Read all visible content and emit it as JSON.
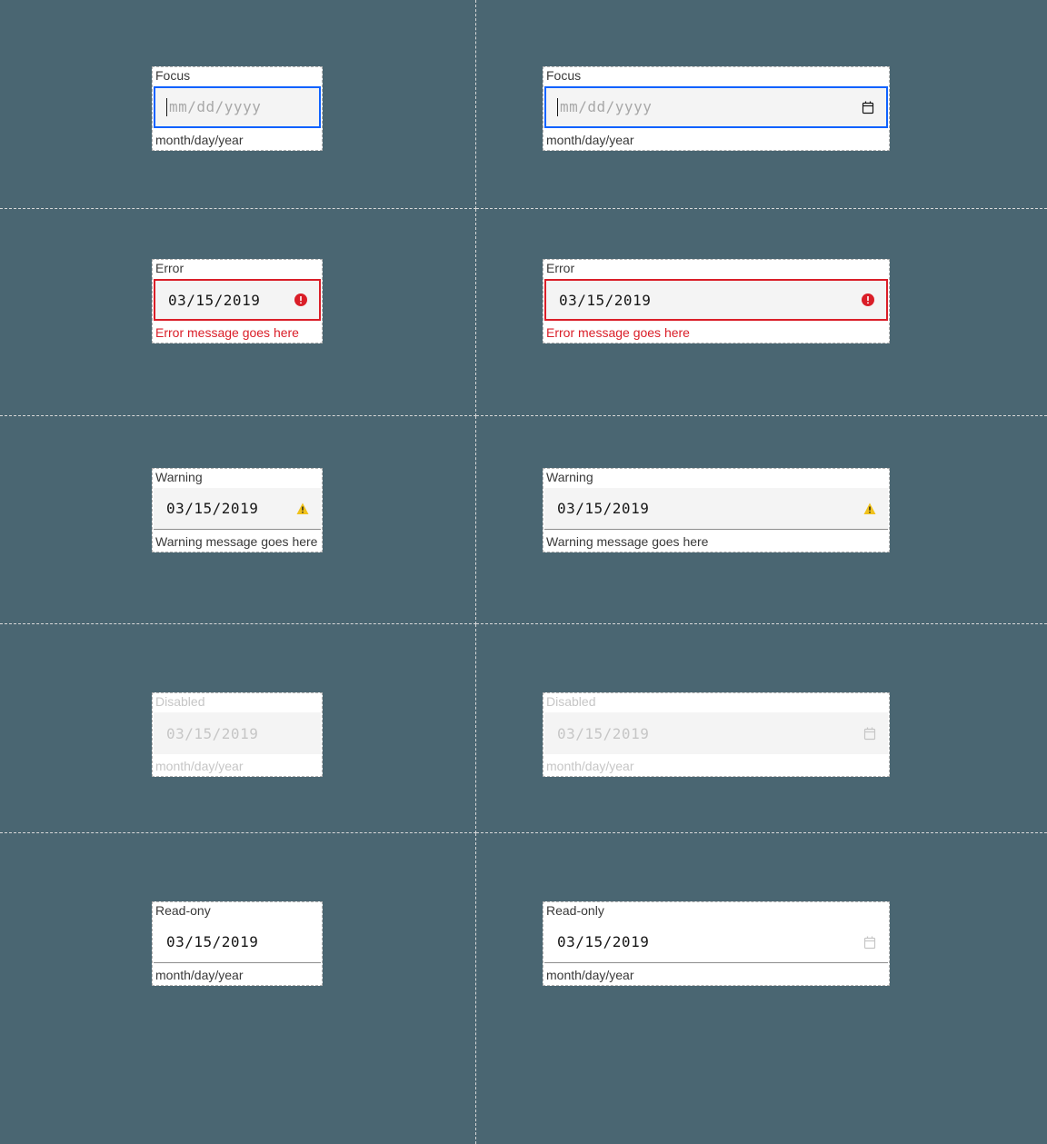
{
  "placeholder": "mm/dd/yyyy",
  "helper_format": "month/day/year",
  "value_date": "03/15/2019",
  "labels": {
    "focus": "Focus",
    "error": "Error",
    "warning": "Warning",
    "disabled": "Disabled",
    "readonly_left": "Read-ony",
    "readonly_right": "Read-only"
  },
  "messages": {
    "error": "Error message goes here",
    "warning": "Warning message goes here"
  }
}
